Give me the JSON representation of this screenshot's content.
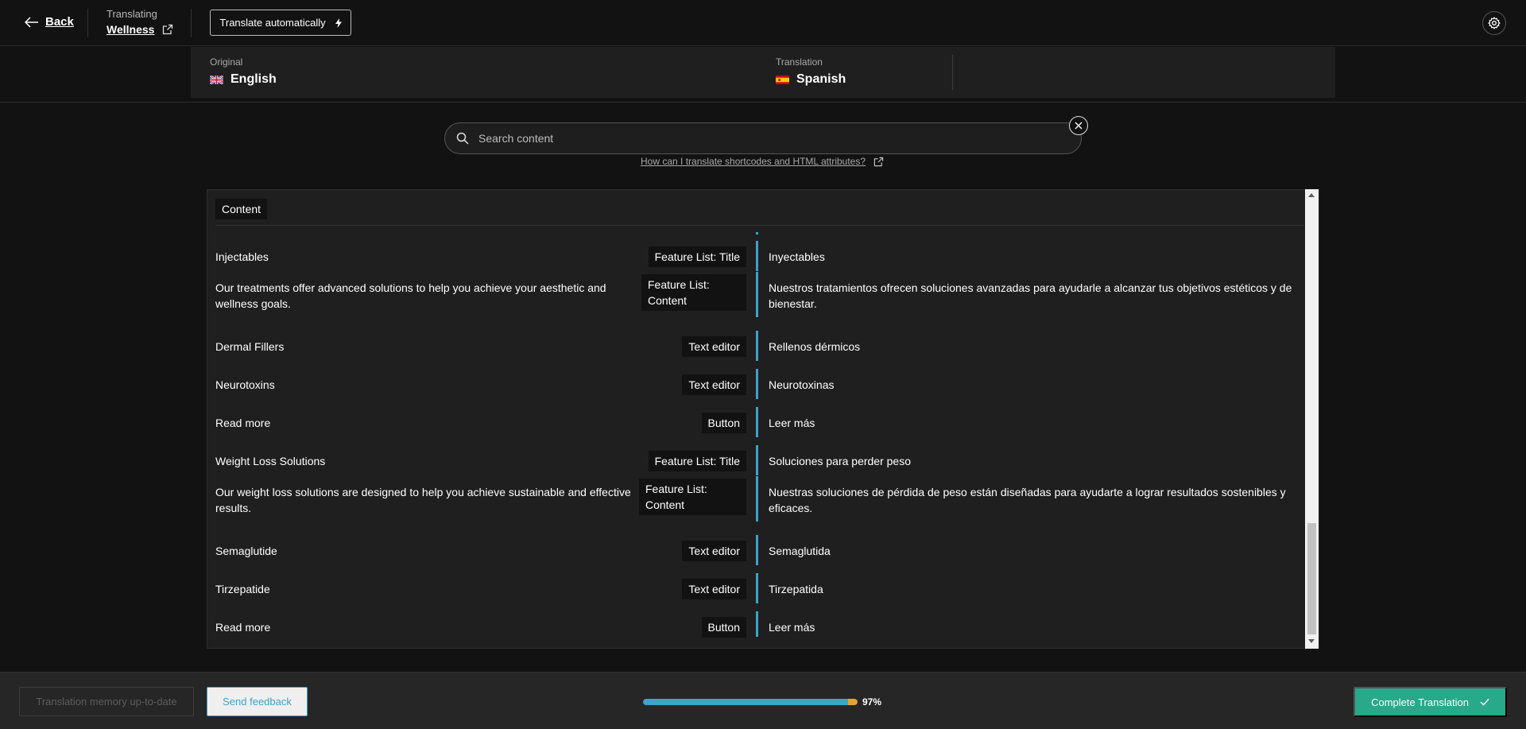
{
  "header": {
    "back_label": "Back",
    "translating_label": "Translating",
    "page_title": "Wellness",
    "auto_translate_label": "Translate automatically"
  },
  "languages": {
    "original_label": "Original",
    "original_value": "English",
    "translation_label": "Translation",
    "translation_value": "Spanish"
  },
  "search": {
    "placeholder": "Search content",
    "help_link": "How can I translate shortcodes and HTML attributes?"
  },
  "content": {
    "section_label": "Content",
    "rows": [
      {
        "original": "Injectables",
        "type": "Feature List: Title",
        "translation": "Inyectables"
      },
      {
        "original": "Our treatments offer advanced solutions to help you achieve your aesthetic and wellness goals.",
        "type": "Feature List: Content",
        "translation": "Nuestros tratamientos ofrecen soluciones avanzadas para ayudarle a alcanzar tus objetivos estéticos y de bienestar."
      },
      {
        "original": "Dermal Fillers",
        "type": "Text editor",
        "translation": "Rellenos dérmicos"
      },
      {
        "original": "Neurotoxins",
        "type": "Text editor",
        "translation": "Neurotoxinas"
      },
      {
        "original": "Read more",
        "type": "Button",
        "translation": "Leer más"
      },
      {
        "original": "Weight Loss Solutions",
        "type": "Feature List: Title",
        "translation": "Soluciones para perder peso"
      },
      {
        "original": "Our weight loss solutions are designed to help you achieve sustainable and effective results.",
        "type": "Feature List: Content",
        "translation": "Nuestras soluciones de pérdida de peso están diseñadas para ayudarte a lograr resultados sostenibles y eficaces."
      },
      {
        "original": "Semaglutide",
        "type": "Text editor",
        "translation": "Semaglutida"
      },
      {
        "original": "Tirzepatide",
        "type": "Text editor",
        "translation": "Tirzepatida"
      },
      {
        "original": "Read more",
        "type": "Button",
        "translation": "Leer más"
      }
    ]
  },
  "footer": {
    "memory_label": "Translation memory up-to-date",
    "feedback_label": "Send feedback",
    "progress_percent": 97,
    "progress_text": "97%",
    "complete_label": "Complete Translation"
  },
  "colors": {
    "accent": "#3aa4c9",
    "progress_tail": "#e3a32f",
    "complete": "#27a98a"
  }
}
